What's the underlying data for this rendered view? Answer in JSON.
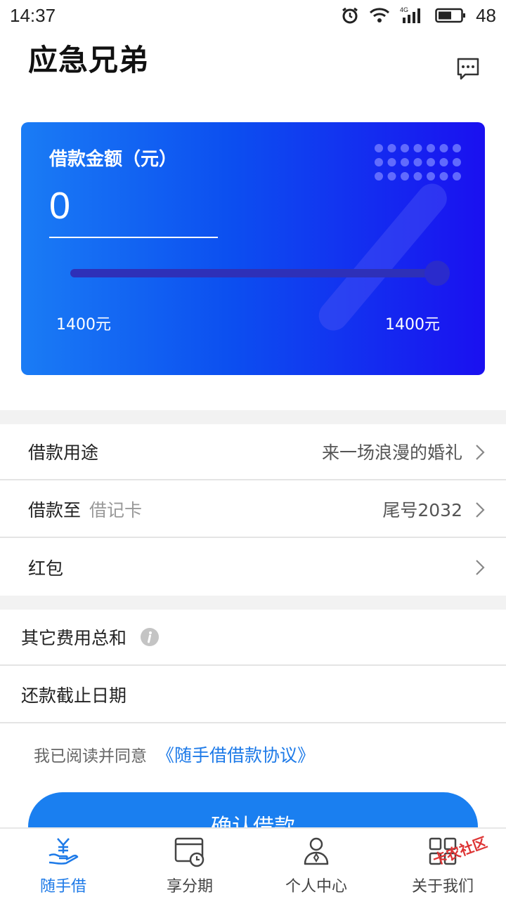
{
  "status": {
    "time": "14:37",
    "network": "4G",
    "battery": "48"
  },
  "header": {
    "title": "应急兄弟",
    "message_icon": "message-dots-icon"
  },
  "card": {
    "label": "借款金额（元）",
    "amount": "0",
    "min_label": "1400元",
    "max_label": "1400元",
    "slider_fraction": 1.0,
    "colors": {
      "start": "#1a7cf5",
      "end": "#1a10f0"
    }
  },
  "rows": {
    "purpose": {
      "label": "借款用途",
      "value": "来一场浪漫的婚礼"
    },
    "to": {
      "label": "借款至",
      "sub": "借记卡",
      "value": "尾号2032"
    },
    "redpacket": {
      "label": "红包"
    },
    "fees": {
      "label": "其它费用总和"
    },
    "due": {
      "label": "还款截止日期"
    }
  },
  "agreement": {
    "text": "我已阅读并同意",
    "link": "《随手借借款协议》"
  },
  "confirm": {
    "label": "确认借款"
  },
  "tabs": [
    {
      "label": "随手借",
      "icon": "hand-yen-icon",
      "active": true
    },
    {
      "label": "享分期",
      "icon": "installment-clock-icon",
      "active": false
    },
    {
      "label": "个人中心",
      "icon": "person-icon",
      "active": false
    },
    {
      "label": "关于我们",
      "icon": "grid-icon",
      "active": false
    }
  ],
  "watermark": "卡农社区",
  "accent_color": "#1d7ae8"
}
